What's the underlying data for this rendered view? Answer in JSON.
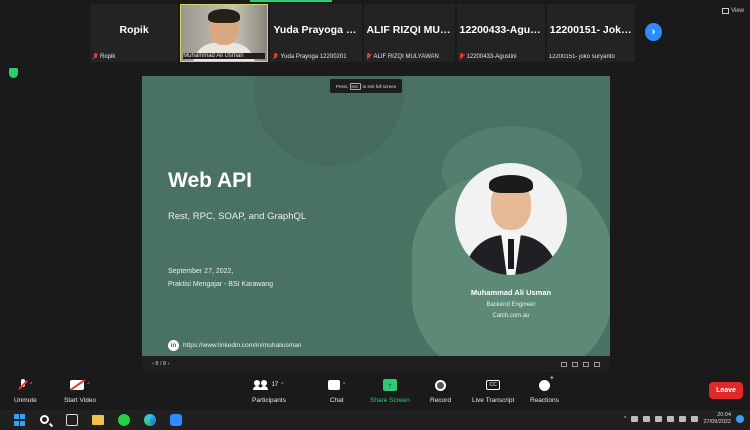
{
  "participants": [
    {
      "name": "Ropik",
      "label": "Ropik",
      "muted": true
    },
    {
      "name": "",
      "label": "Muhammad Ali Usman",
      "muted": false,
      "video": true
    },
    {
      "name": "Yuda Prayoga 1...",
      "label": "Yuda Prayoga 12200201",
      "muted": true
    },
    {
      "name": "ALIF RIZQI MUL...",
      "label": "ALIF RIZQI MULYAWAN",
      "muted": true
    },
    {
      "name": "12200433-Agus...",
      "label": "12200433-Agustini",
      "muted": true
    },
    {
      "name": "12200151- Joko...",
      "label": "12200151- joko suryanto",
      "muted": false
    }
  ],
  "view_label": "View",
  "next_arrow": "›",
  "esc_hint": {
    "before": "Press",
    "key": "esc",
    "after": "to exit full screen"
  },
  "slide": {
    "title": "Web API",
    "subtitle": "Rest, RPC, SOAP, and GraphQL",
    "date": "September 27, 2022,",
    "event": "Praktisi Mengajar - BSI Karawang",
    "link": "https://www.linkedin.com/in/muhaliusman",
    "linkedin_icon": "in",
    "speaker_name": "Muhammad Ali Usman",
    "speaker_role": "Backend Engineer",
    "speaker_company": "Catch.com.au"
  },
  "slide_bar": {
    "page": "‹  8 / 8  ›"
  },
  "toolbar": {
    "unmute": "Unmute",
    "start_video": "Start Video",
    "participants": "Participants",
    "participants_count": "17",
    "chat": "Chat",
    "share_screen": "Share Screen",
    "record": "Record",
    "live_transcript": "Live Transcript",
    "reactions": "Reactions",
    "leave": "Leave",
    "cc": "CC",
    "caret": "^"
  },
  "taskbar": {
    "time": "20:04",
    "date": "27/09/2022"
  },
  "colors": {
    "slide_bg": "#4a7262",
    "share_green": "#2ecc71",
    "leave_red": "#e02828",
    "zoom_blue": "#2d8cff"
  }
}
